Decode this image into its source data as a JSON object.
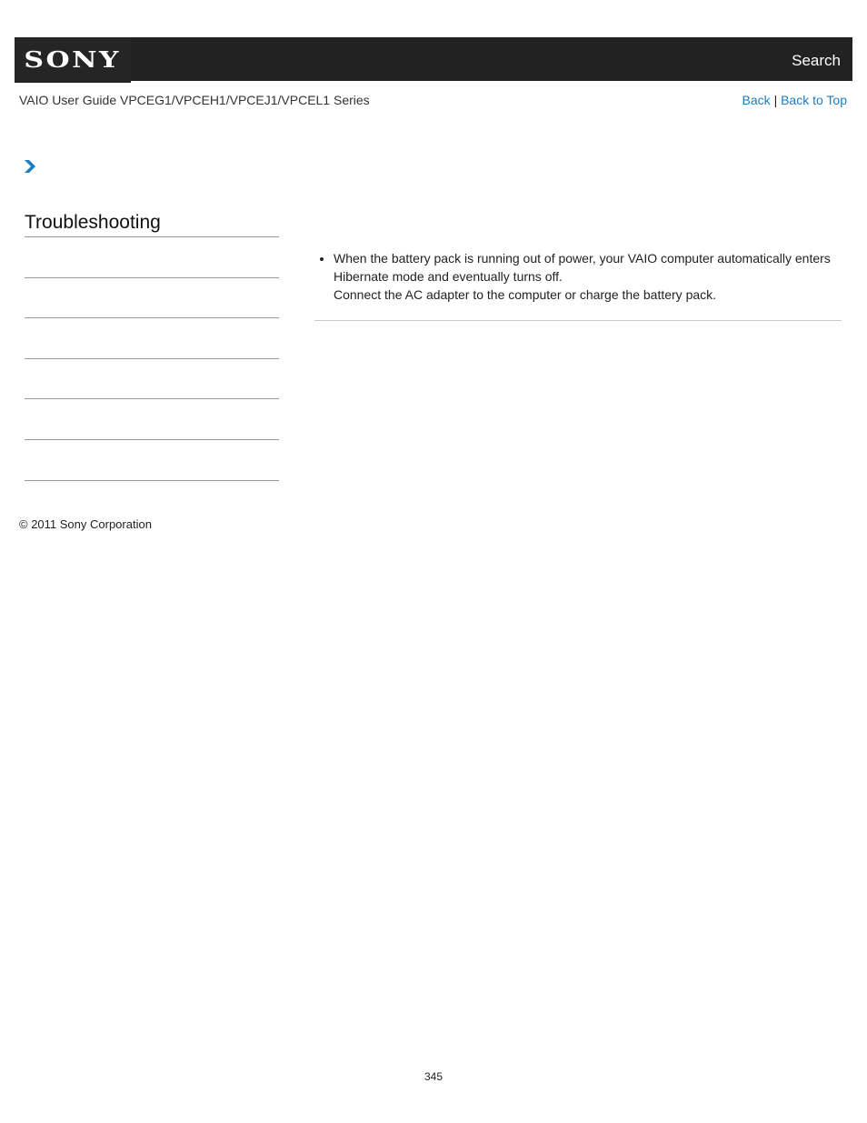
{
  "header": {
    "logo": "SONY",
    "search_label": "Search"
  },
  "subheader": {
    "guide_title": "VAIO User Guide VPCEG1/VPCEH1/VPCEJ1/VPCEL1 Series",
    "back_label": "Back",
    "separator": "|",
    "back_to_top_label": "Back to Top"
  },
  "breadcrumb": {
    "icon": "chevron-right-icon",
    "color": "#1a7dc4"
  },
  "sidebar": {
    "title": "Troubleshooting",
    "items": [
      "",
      "",
      "",
      "",
      "",
      ""
    ]
  },
  "content": {
    "bullets": [
      {
        "line1": "When the battery pack is running out of power, your VAIO computer automatically enters Hibernate mode and eventually turns off.",
        "line2": "Connect the AC adapter to the computer or charge the battery pack."
      }
    ]
  },
  "footer": {
    "copyright": "© 2011 Sony Corporation",
    "page_number": "345"
  },
  "colors": {
    "header_bg": "#222222",
    "link": "#1a7dc4"
  }
}
